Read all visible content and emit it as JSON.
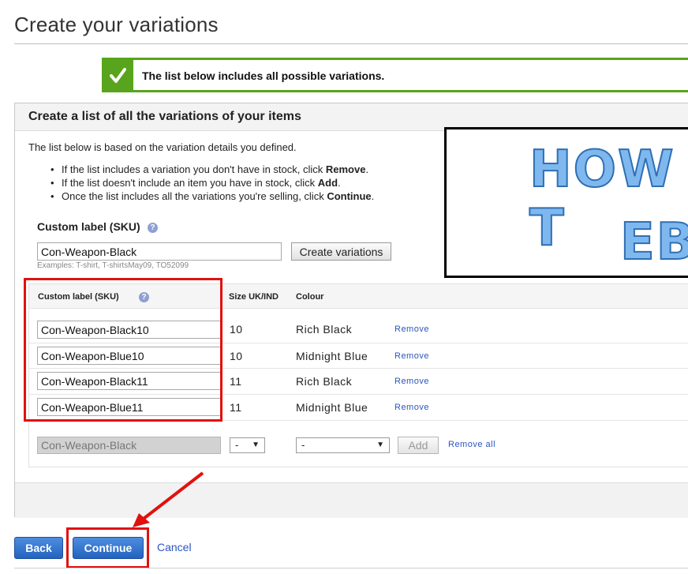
{
  "page_title": "Create your variations",
  "banner": {
    "text": "The list below includes all possible variations.",
    "icon": "check-icon",
    "color": "#58a41c"
  },
  "panel": {
    "title": "Create a list of all the variations of your items",
    "intro": "The list below is based on the variation details you defined.",
    "bullets": [
      {
        "pre": "If the list includes a variation you don't have in stock, click ",
        "bold": "Remove",
        "post": "."
      },
      {
        "pre": "If the list doesn't include an item you have in stock, click ",
        "bold": "Add",
        "post": "."
      },
      {
        "pre": "Once the list includes all the variations you're selling, click ",
        "bold": "Continue",
        "post": "."
      }
    ],
    "sku_label": "Custom label (SKU)",
    "sku_value": "Con-Weapon-Black",
    "sku_examples": "Examples: T-shirt, T-shirtsMay09, TO52099",
    "create_button": "Create variations"
  },
  "overlay": {
    "line1": "HOW T",
    "line2": "EBA"
  },
  "table": {
    "headers": {
      "sku": "Custom label (SKU)",
      "size": "Size UK/IND",
      "colour": "Colour"
    },
    "rows": [
      {
        "sku": "Con-Weapon-Black10",
        "size": "10",
        "colour": "Rich Black",
        "action": "Remove"
      },
      {
        "sku": "Con-Weapon-Blue10",
        "size": "10",
        "colour": "Midnight Blue",
        "action": "Remove"
      },
      {
        "sku": "Con-Weapon-Black11",
        "size": "11",
        "colour": "Rich Black",
        "action": "Remove"
      },
      {
        "sku": "Con-Weapon-Blue11",
        "size": "11",
        "colour": "Midnight Blue",
        "action": "Remove"
      }
    ],
    "new_row": {
      "sku": "Con-Weapon-Black",
      "size_selected": "-",
      "colour_selected": "-",
      "add_button": "Add",
      "remove_all": "Remove all"
    }
  },
  "footer": {
    "back": "Back",
    "continue": "Continue",
    "cancel": "Cancel"
  },
  "colors": {
    "accent_blue": "#2363be",
    "link": "#2a55c0",
    "highlight_red": "#e0120e"
  }
}
